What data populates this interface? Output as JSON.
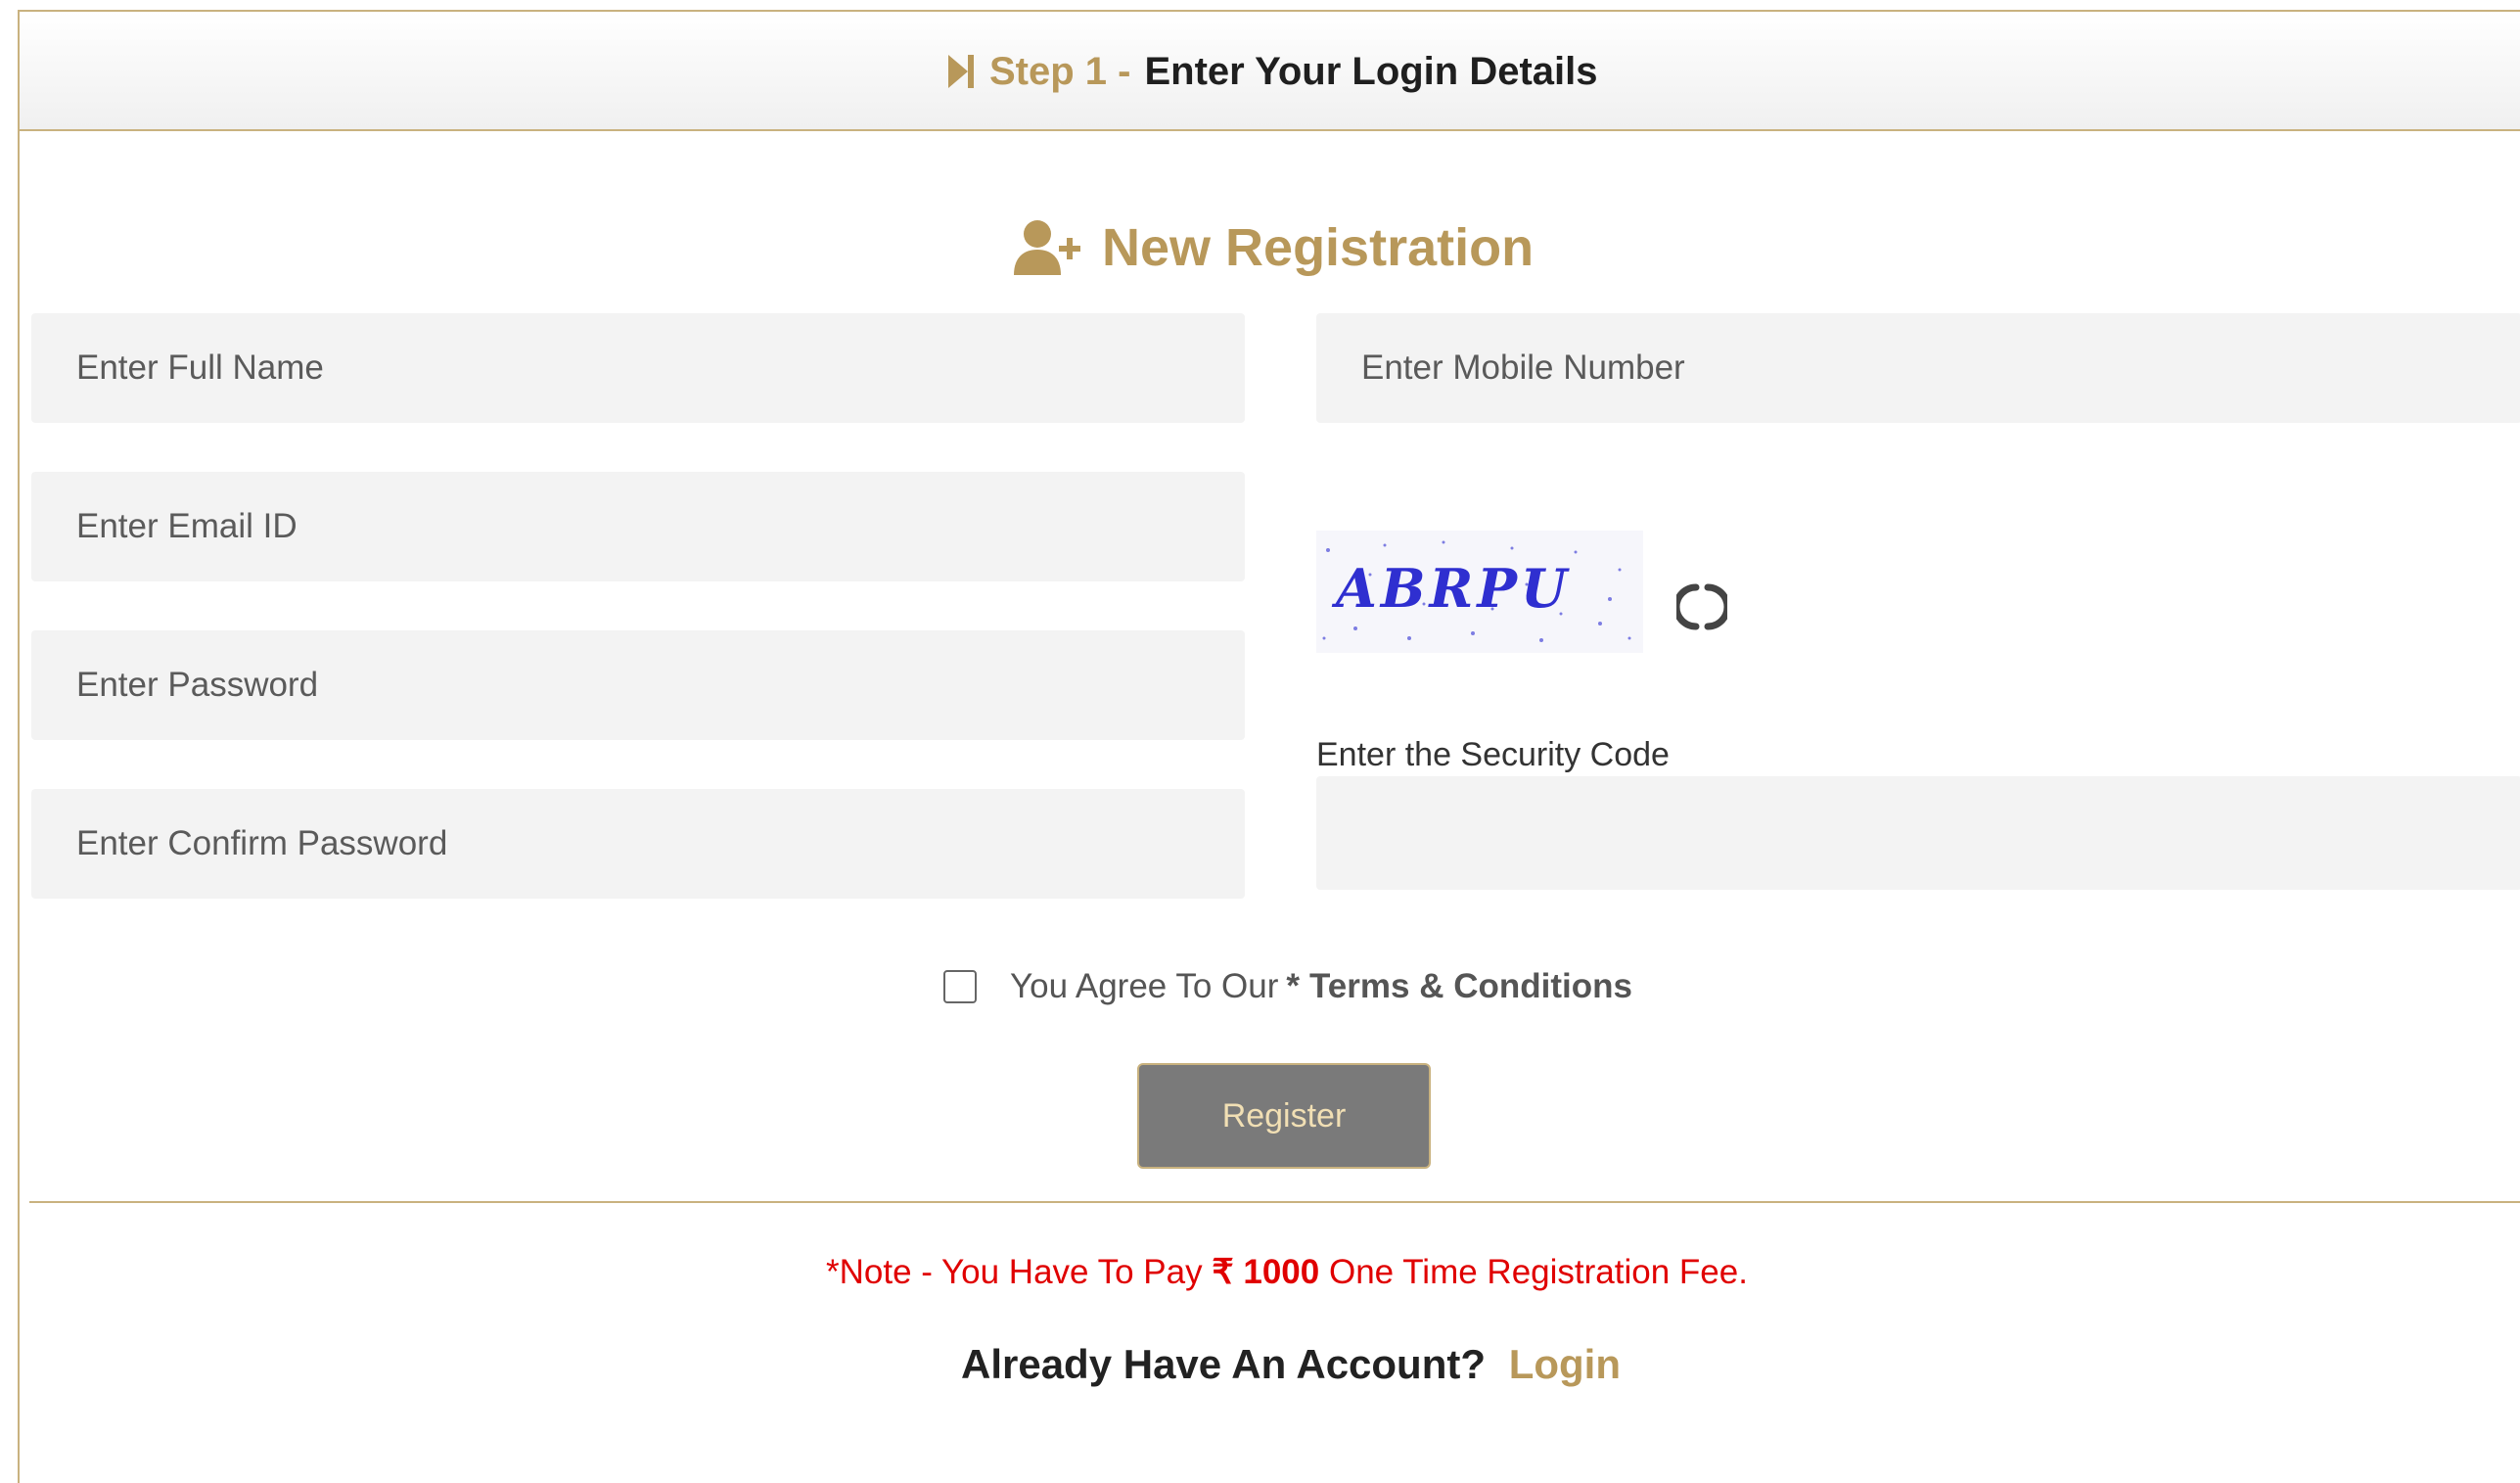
{
  "header": {
    "step_prefix": "Step 1 -",
    "step_title": "Enter Your Login Details",
    "icon": "step-forward-icon"
  },
  "registration": {
    "title": "New Registration",
    "icon": "user-plus-icon"
  },
  "fields": {
    "full_name_placeholder": "Enter Full Name",
    "email_placeholder": "Enter Email ID",
    "password_placeholder": "Enter Password",
    "confirm_password_placeholder": "Enter Confirm Password",
    "mobile_placeholder": "Enter Mobile Number"
  },
  "captcha": {
    "code": "ABRPU",
    "refresh_icon": "refresh-icon",
    "security_label": "Enter the Security Code"
  },
  "agreement": {
    "text": "You Agree To Our",
    "asterisk": "*",
    "terms_label": "Terms & Conditions"
  },
  "register_button": "Register",
  "note": {
    "prefix": "*Note - You Have To Pay",
    "currency": "₹",
    "amount": "1000",
    "suffix": "One Time Registration Fee."
  },
  "login_prompt": {
    "text": "Already Have An Account?",
    "link": "Login"
  },
  "colors": {
    "accent": "#b8985a",
    "border": "#c9b27f",
    "note": "#e00000",
    "button_bg": "#7a7a7a"
  }
}
